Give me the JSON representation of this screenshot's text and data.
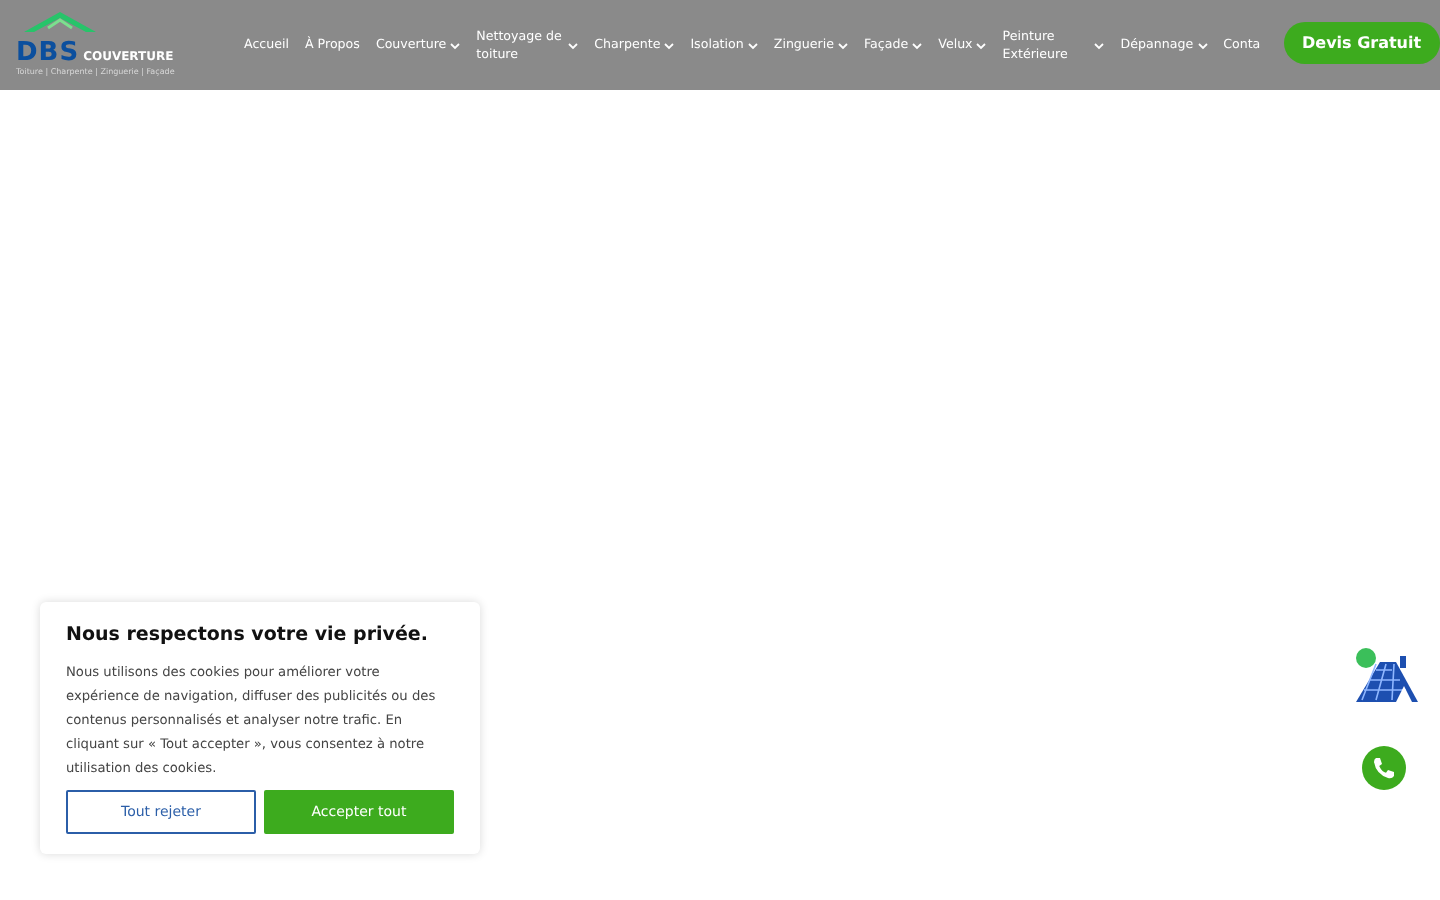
{
  "logo": {
    "brand": "DBS",
    "name": "COUVERTURE",
    "tagline": "Toiture | Charpente | Zinguerie | Façade"
  },
  "nav": [
    {
      "label": "Accueil",
      "kind": "link"
    },
    {
      "label": "À Propos",
      "kind": "link"
    },
    {
      "label": "Couverture",
      "kind": "dropdown"
    },
    {
      "label": "Nettoyage de toiture",
      "kind": "dropdown"
    },
    {
      "label": "Charpente",
      "kind": "dropdown"
    },
    {
      "label": "Isolation",
      "kind": "dropdown"
    },
    {
      "label": "Zinguerie",
      "kind": "dropdown"
    },
    {
      "label": "Façade",
      "kind": "dropdown"
    },
    {
      "label": "Velux",
      "kind": "dropdown"
    },
    {
      "label": "Peinture Extérieure",
      "kind": "dropdown"
    },
    {
      "label": "Dépannage",
      "kind": "dropdown"
    },
    {
      "label": "Conta",
      "kind": "link"
    }
  ],
  "cta": "Devis Gratuit",
  "cookie": {
    "title": "Nous respectons votre vie privée.",
    "text": "Nous utilisons des cookies pour améliorer votre expérience de navigation, diffuser des publicités ou des contenus personnalisés et analyser notre trafic. En cliquant sur « Tout accepter », vous consentez à notre utilisation des cookies.",
    "buttons": [
      {
        "label": "Tout rejeter",
        "kind": "outline"
      },
      {
        "label": "Accepter tout",
        "kind": "filled"
      }
    ]
  }
}
